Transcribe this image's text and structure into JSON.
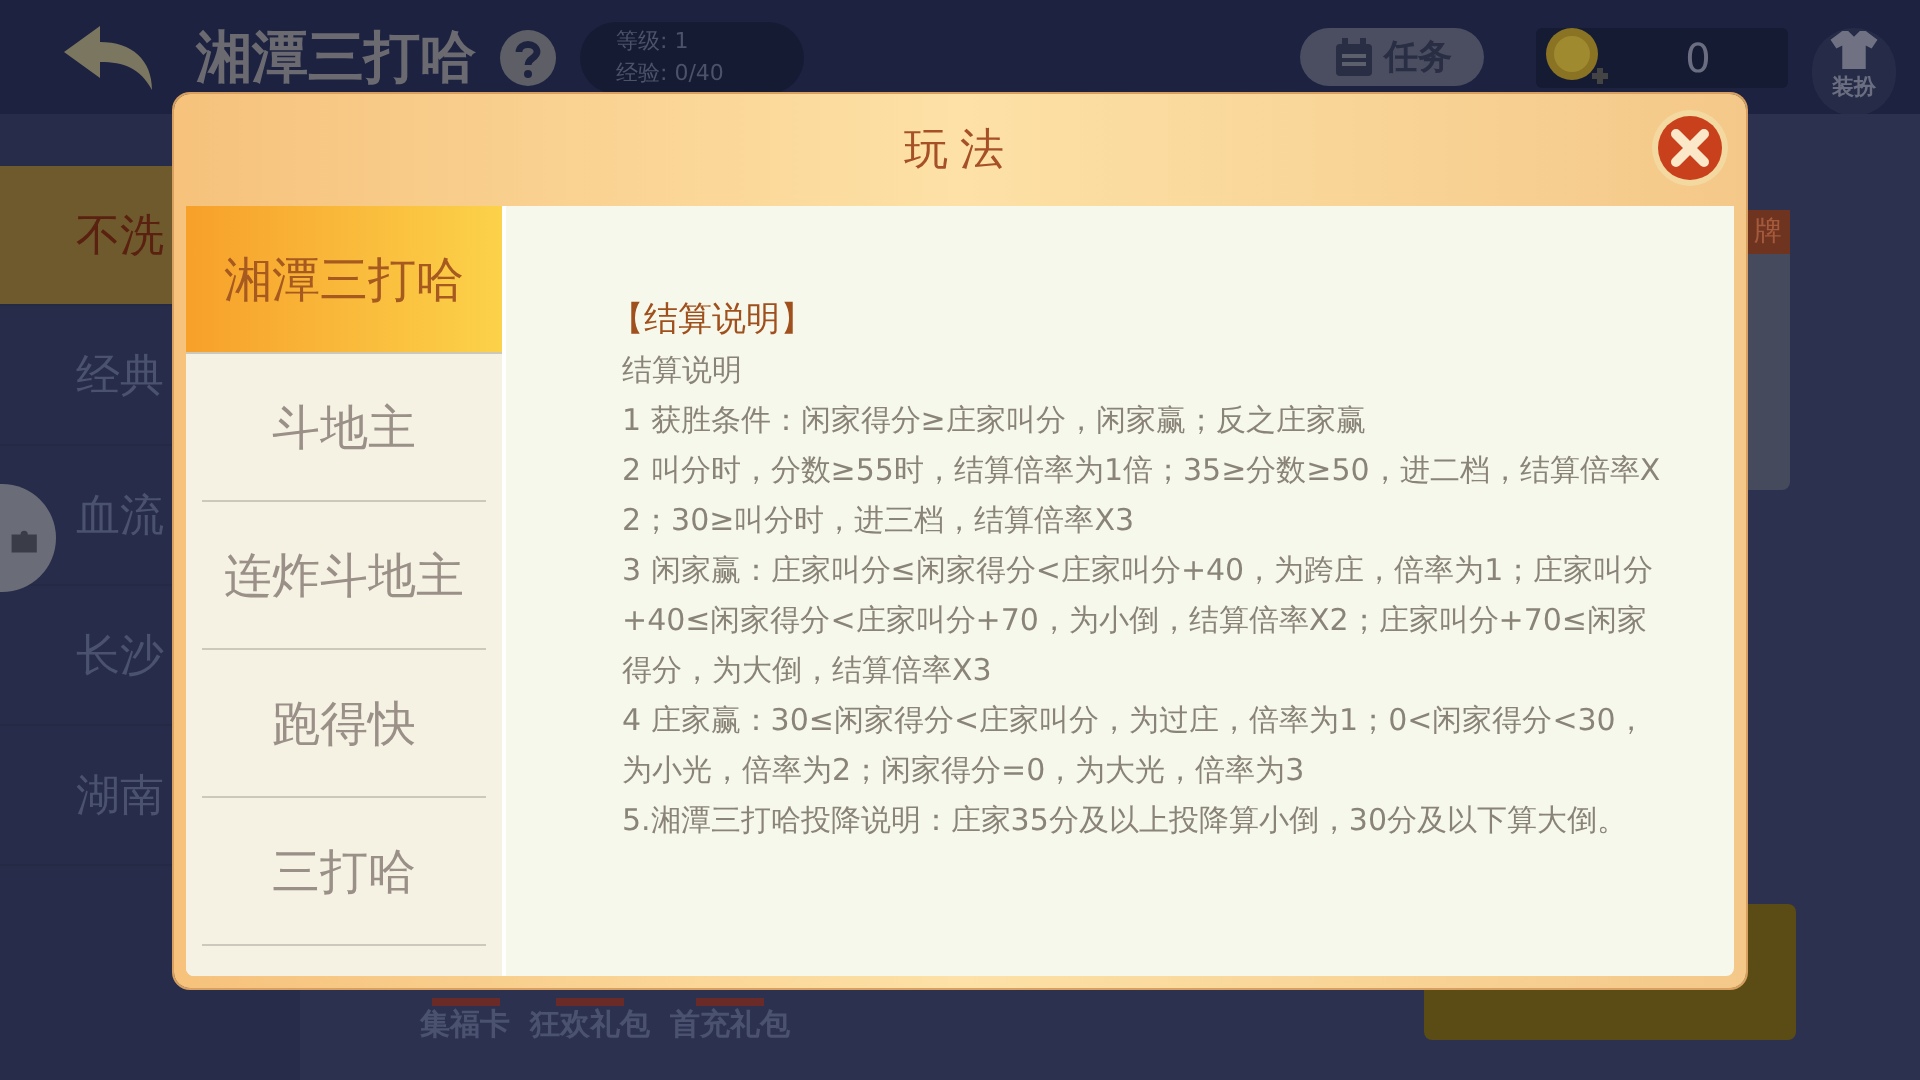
{
  "top_bar": {
    "title": "湘潭三打哈",
    "level": "等级: 1",
    "experience": "经验: 0/40",
    "task_button": "任务",
    "coins": "0",
    "outfit_label": "装扮"
  },
  "mode_list": [
    {
      "label": "不洗",
      "selected": true
    },
    {
      "label": "经典",
      "selected": false
    },
    {
      "label": "血流",
      "selected": false
    },
    {
      "label": "长沙",
      "selected": false
    },
    {
      "label": "湖南",
      "selected": false
    }
  ],
  "card_tag": "牌",
  "bottom_items": [
    "集福卡",
    "狂欢礼包",
    "首充礼包"
  ],
  "dialog": {
    "title": "玩法",
    "tabs": [
      {
        "label": "湘潭三打哈",
        "selected": true
      },
      {
        "label": "斗地主",
        "selected": false
      },
      {
        "label": "连炸斗地主",
        "selected": false
      },
      {
        "label": "跑得快",
        "selected": false
      },
      {
        "label": "三打哈",
        "selected": false
      }
    ],
    "section_heading": "【结算说明】",
    "paragraphs": [
      "结算说明",
      "1 获胜条件：闲家得分≥庄家叫分，闲家赢；反之庄家赢",
      "2 叫分时，分数≥55时，结算倍率为1倍；35≥分数≥50，进二档，结算倍率X2；30≥叫分时，进三档，结算倍率X3",
      "3 闲家赢：庄家叫分≤闲家得分<庄家叫分+40，为跨庄，倍率为1；庄家叫分+40≤闲家得分<庄家叫分+70，为小倒，结算倍率X2；庄家叫分+70≤闲家得分，为大倒，结算倍率X3",
      "4 庄家赢：30≤闲家得分<庄家叫分，为过庄，倍率为1；0<闲家得分<30，为小光，倍率为2；闲家得分=0，为大光，倍率为3",
      "5.湘潭三打哈投降说明：庄家35分及以上投降算小倒，30分及以下算大倒。"
    ]
  }
}
